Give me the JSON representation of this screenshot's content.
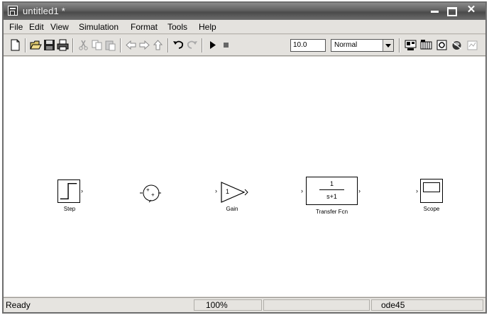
{
  "window": {
    "title": "untitled1 *"
  },
  "menu": [
    "File",
    "Edit",
    "View",
    "Simulation",
    "Format",
    "Tools",
    "Help"
  ],
  "toolbar": {
    "stop_time": "10.0",
    "sim_mode": "Normal"
  },
  "blocks": {
    "step": {
      "label": "Step"
    },
    "sum": {
      "sign1": "+",
      "sign2": "+"
    },
    "gain": {
      "value": "1",
      "label": "Gain"
    },
    "transfer_fcn": {
      "numerator": "1",
      "denominator": "s+1",
      "label": "Transfer Fcn"
    },
    "scope": {
      "label": "Scope"
    }
  },
  "status": {
    "state": "Ready",
    "zoom": "100%",
    "solver": "ode45"
  }
}
